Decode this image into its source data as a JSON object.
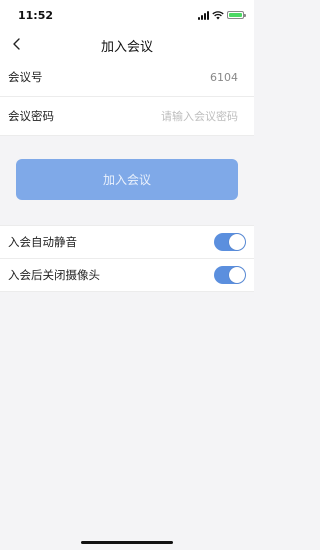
{
  "status_bar": {
    "time": "11:52"
  },
  "nav": {
    "title": "加入会议"
  },
  "form": {
    "meeting_id_label": "会议号",
    "meeting_id_value": "6104",
    "password_label": "会议密码",
    "password_placeholder": "请输入会议密码"
  },
  "join_button": {
    "label": "加入会议",
    "color": "#7fa9e8"
  },
  "options": [
    {
      "label": "入会自动静音",
      "enabled": true
    },
    {
      "label": "入会后关闭摄像头",
      "enabled": true
    }
  ],
  "colors": {
    "accent": "#5b8fde",
    "battery": "#4cd964"
  }
}
